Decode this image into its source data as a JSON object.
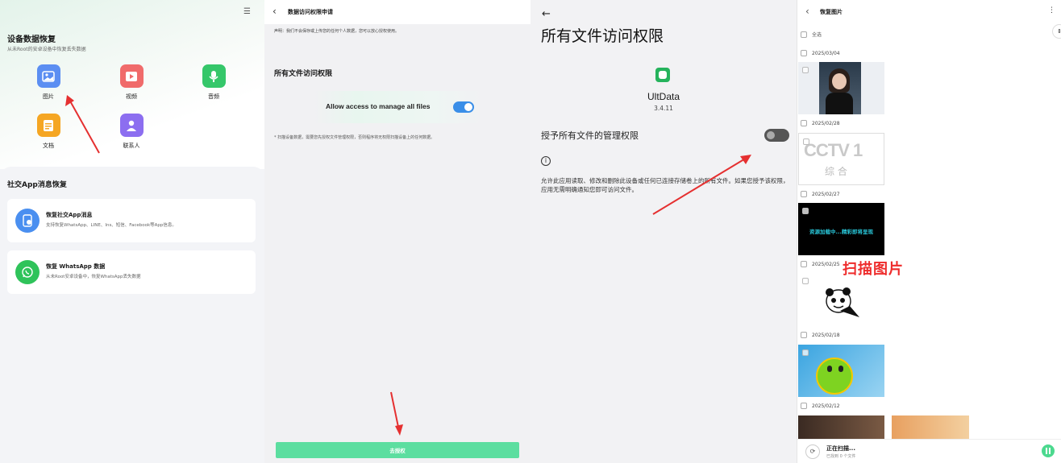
{
  "panel1": {
    "device_section_title": "设备数据恢复",
    "device_section_sub": "从未Root的安卓设备中恢复丢失数据",
    "tiles": [
      {
        "label": "图片",
        "icon": "image-icon",
        "color": "#5b8ef2"
      },
      {
        "label": "视频",
        "icon": "video-icon",
        "color": "#f06b6b"
      },
      {
        "label": "音频",
        "icon": "microphone-icon",
        "color": "#35c76a"
      },
      {
        "label": "文档",
        "icon": "document-icon",
        "color": "#f5a623"
      },
      {
        "label": "联系人",
        "icon": "contact-icon",
        "color": "#8c6ef0"
      }
    ],
    "social_title": "社交App消息恢复",
    "cards": [
      {
        "title": "恢复社交App消息",
        "sub": "支持恢复WhatsApp、LINE、Ins、短信、Facebook等App信息。",
        "icon": "chat-app-icon",
        "color": "#4a8ff0"
      },
      {
        "title": "恢复 WhatsApp 数据",
        "sub": "从未Root安卓设备中，恢复WhatsApp丢失数据",
        "icon": "whatsapp-icon",
        "color": "#2fc35a"
      }
    ]
  },
  "panel2": {
    "title": "数据访问权限申请",
    "notice": "声明：我们不会保存或上传您的任何个人数据，您可以放心授权使用。",
    "heading": "所有文件访问权限",
    "allow_text": "Allow access to manage all files",
    "note": "* 扫描设备数据，需要您先授权文件管理权限，否则程序将无权限扫描设备上的任何数据。",
    "button": "去授权"
  },
  "panel3": {
    "title": "所有文件访问权限",
    "app_name": "UltData",
    "version": "3.4.11",
    "grant_label": "授予所有文件的管理权限",
    "description": "允许此应用读取、修改和删除此设备或任何已连接存储卷上的所有文件。如果您授予该权限，应用无需明确通知您即可访问文件。"
  },
  "panel4": {
    "title": "恢复图片",
    "select_all": "全选",
    "dates": [
      "2025/03/04",
      "2025/02/28",
      "2025/02/27",
      "2025/02/25",
      "2025/02/18",
      "2025/02/12"
    ],
    "thumb_cctv_text": "CCTV 1",
    "thumb_cctv_sub": "综 合",
    "thumb_loading_text": "资源加载中...精彩即将呈现",
    "scan_label": "扫描图片",
    "scanning": "正在扫描...",
    "scanning_sub": "已找到 0 个文件"
  }
}
